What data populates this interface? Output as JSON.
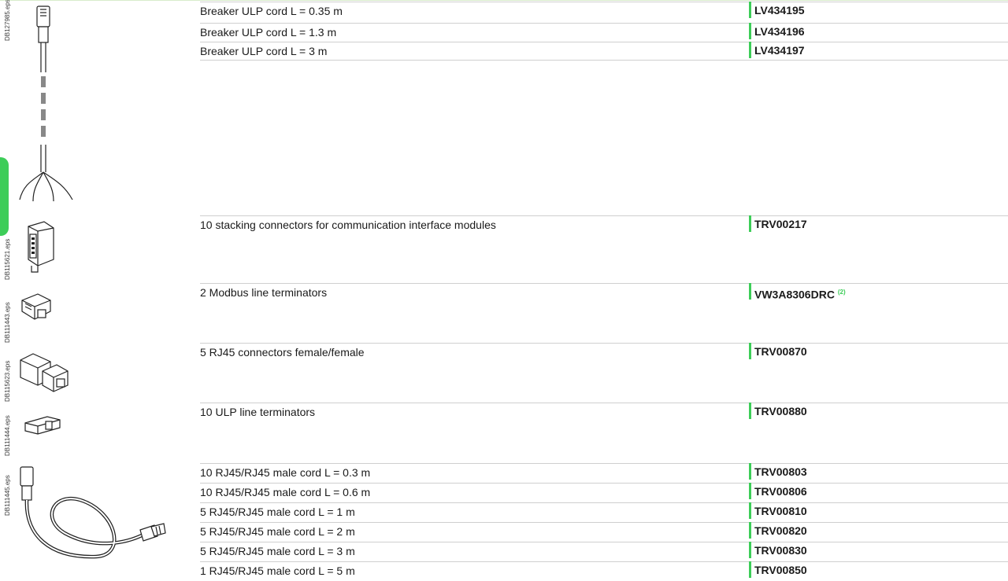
{
  "figure_labels": [
    "DB127985.eps",
    "DB115621.eps",
    "DB111443.eps",
    "DB115623.eps",
    "DB111444.eps",
    "DB111445.eps"
  ],
  "groups": {
    "ulp_cords": [
      {
        "desc": "Breaker ULP cord L = 0.35 m",
        "ref": "LV434195"
      },
      {
        "desc": "Breaker ULP cord L = 1.3 m",
        "ref": "LV434196"
      },
      {
        "desc": "Breaker ULP cord L = 3 m",
        "ref": "LV434197"
      }
    ],
    "stacking": {
      "desc": "10 stacking connectors for communication interface modules",
      "ref": "TRV00217"
    },
    "modbus_terminators": {
      "desc": "2 Modbus line terminators",
      "ref": "VW3A8306DRC",
      "note": "(2)"
    },
    "rj45_connectors": {
      "desc": "5 RJ45 connectors female/female",
      "ref": "TRV00870"
    },
    "ulp_terminators": {
      "desc": "10 ULP line terminators",
      "ref": "TRV00880"
    },
    "rj45_cords": [
      {
        "desc": "10 RJ45/RJ45 male cord L = 0.3 m",
        "ref": "TRV00803"
      },
      {
        "desc": "10 RJ45/RJ45 male cord L = 0.6 m",
        "ref": "TRV00806"
      },
      {
        "desc": "5 RJ45/RJ45 male cord L = 1 m",
        "ref": "TRV00810"
      },
      {
        "desc": "5 RJ45/RJ45 male cord L = 2 m",
        "ref": "TRV00820"
      },
      {
        "desc": "5 RJ45/RJ45 male cord L = 3 m",
        "ref": "TRV00830"
      },
      {
        "desc": "1 RJ45/RJ45 male cord L = 5 m",
        "ref": "TRV00850"
      }
    ]
  }
}
